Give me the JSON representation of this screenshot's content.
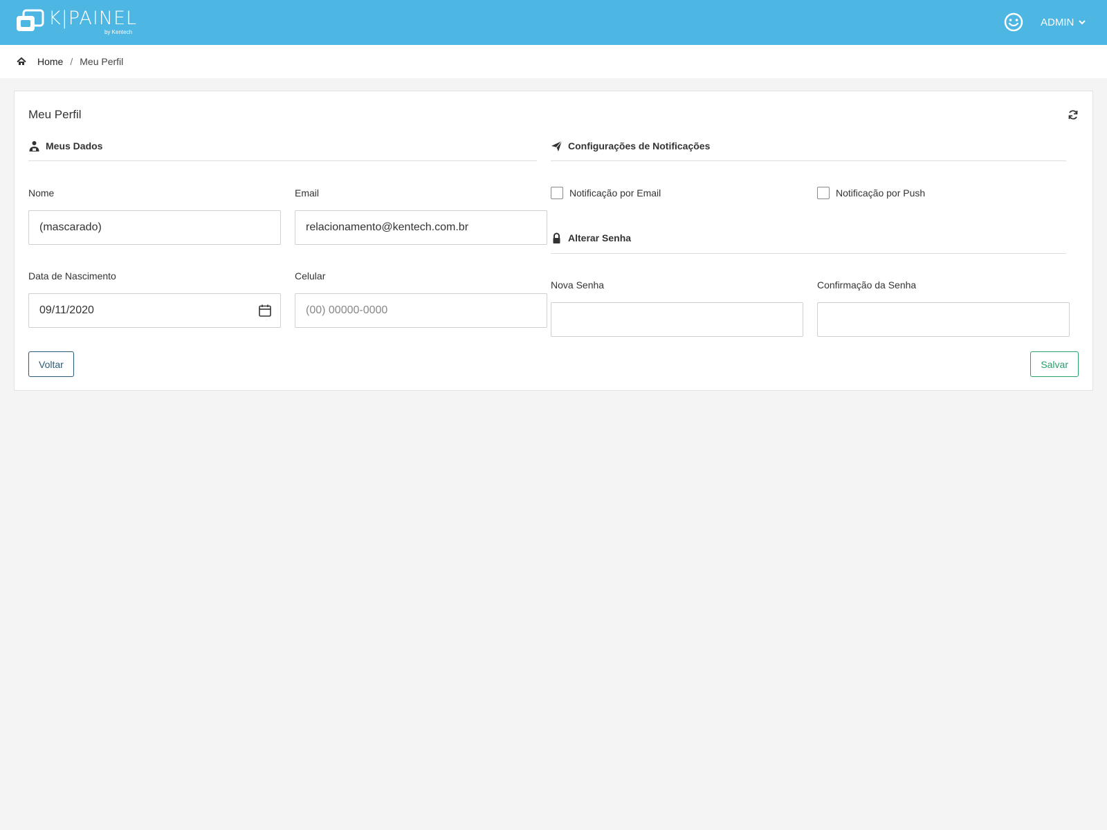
{
  "header": {
    "logo_text": "K|PAINEL",
    "logo_sub": "by Kentech",
    "user_label": "ADMIN"
  },
  "breadcrumb": {
    "home": "Home",
    "separator": "/",
    "current": "Meu Perfil"
  },
  "card": {
    "title": "Meu Perfil"
  },
  "sections": {
    "meus_dados": "Meus Dados",
    "notificacoes": "Configurações de Notificações",
    "alterar_senha": "Alterar Senha"
  },
  "fields": {
    "nome": {
      "label": "Nome",
      "value": "(mascarado)"
    },
    "email": {
      "label": "Email",
      "value": "relacionamento@kentech.com.br"
    },
    "nascimento": {
      "label": "Data de Nascimento",
      "value": "09/11/2020"
    },
    "celular": {
      "label": "Celular",
      "value": "",
      "placeholder": "(00) 00000-0000"
    },
    "nova_senha": {
      "label": "Nova Senha",
      "value": ""
    },
    "confirmacao_senha": {
      "label": "Confirmação da Senha",
      "value": ""
    }
  },
  "notifications": {
    "email": {
      "label": "Notificação por Email",
      "checked": false
    },
    "push": {
      "label": "Notificação por Push",
      "checked": false
    }
  },
  "buttons": {
    "back": "Voltar",
    "save": "Salvar"
  },
  "colors": {
    "topbar": "#4db6e2",
    "back_button": "#2b5a78",
    "save_button": "#27a06a"
  }
}
